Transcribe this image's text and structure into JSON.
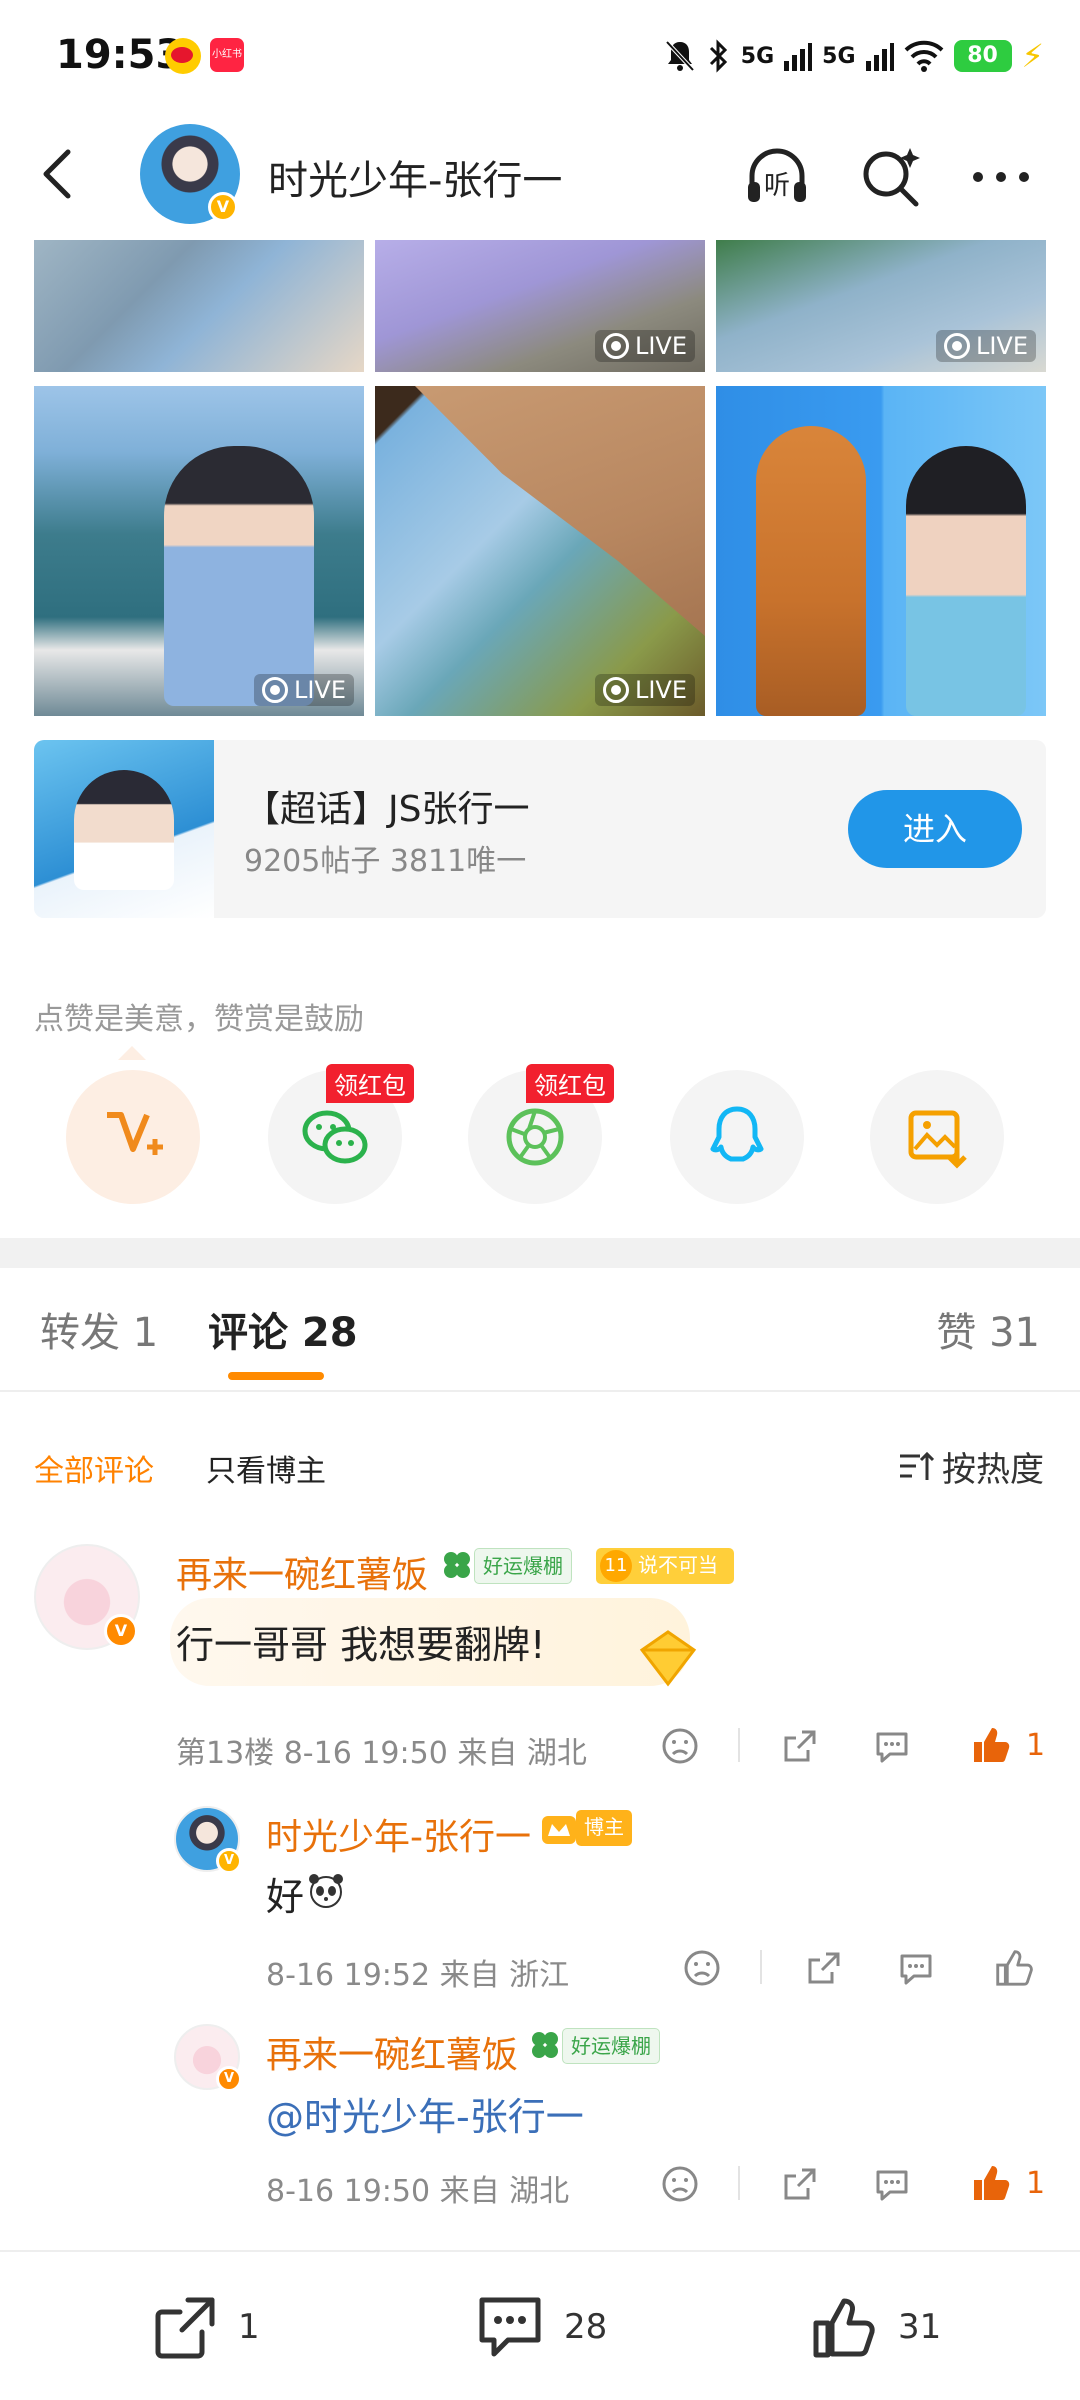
{
  "status_bar": {
    "time": "19:53",
    "net1": "5G",
    "net2": "5G",
    "battery": "80"
  },
  "header": {
    "title": "时光少年-张行一",
    "listen_label": "听"
  },
  "photos": {
    "live_label": "LIVE"
  },
  "supertopic": {
    "title": "【超话】JS张行一",
    "meta": "9205帖子 3811唯一",
    "enter_label": "进入"
  },
  "reward": {
    "hint": "点赞是美意，赞赏是鼓励",
    "redpack_label": "领红包"
  },
  "tabs": {
    "repost": "转发 1",
    "comments": "评论 28",
    "likes": "赞 31"
  },
  "filters": {
    "all": "全部评论",
    "blogger_only": "只看博主",
    "sort": "按热度"
  },
  "comments": [
    {
      "name": "再来一碗红薯饭",
      "tag_luck": "好运爆棚",
      "tag_level": "说不可当",
      "level_num": "11",
      "text": "行一哥哥 我想要翻牌!",
      "meta": "第13楼 8-16 19:50 来自 湖北",
      "likes": "1",
      "replies": [
        {
          "name": "时光少年-张行一",
          "tag_blogger": "博主",
          "text": "好",
          "meta": "8-16 19:52 来自 浙江"
        },
        {
          "name": "再来一碗红薯饭",
          "tag_luck": "好运爆棚",
          "text": "@时光少年-张行一",
          "meta": "8-16 19:50 来自 湖北",
          "likes": "1"
        }
      ]
    }
  ],
  "bottom_bar": {
    "reposts": "1",
    "comments": "28",
    "likes": "31"
  },
  "colors": {
    "accent_orange": "#ff8a00",
    "name_orange": "#e8710a",
    "enter_blue": "#2196e8",
    "redpack_red": "#f2202e"
  }
}
